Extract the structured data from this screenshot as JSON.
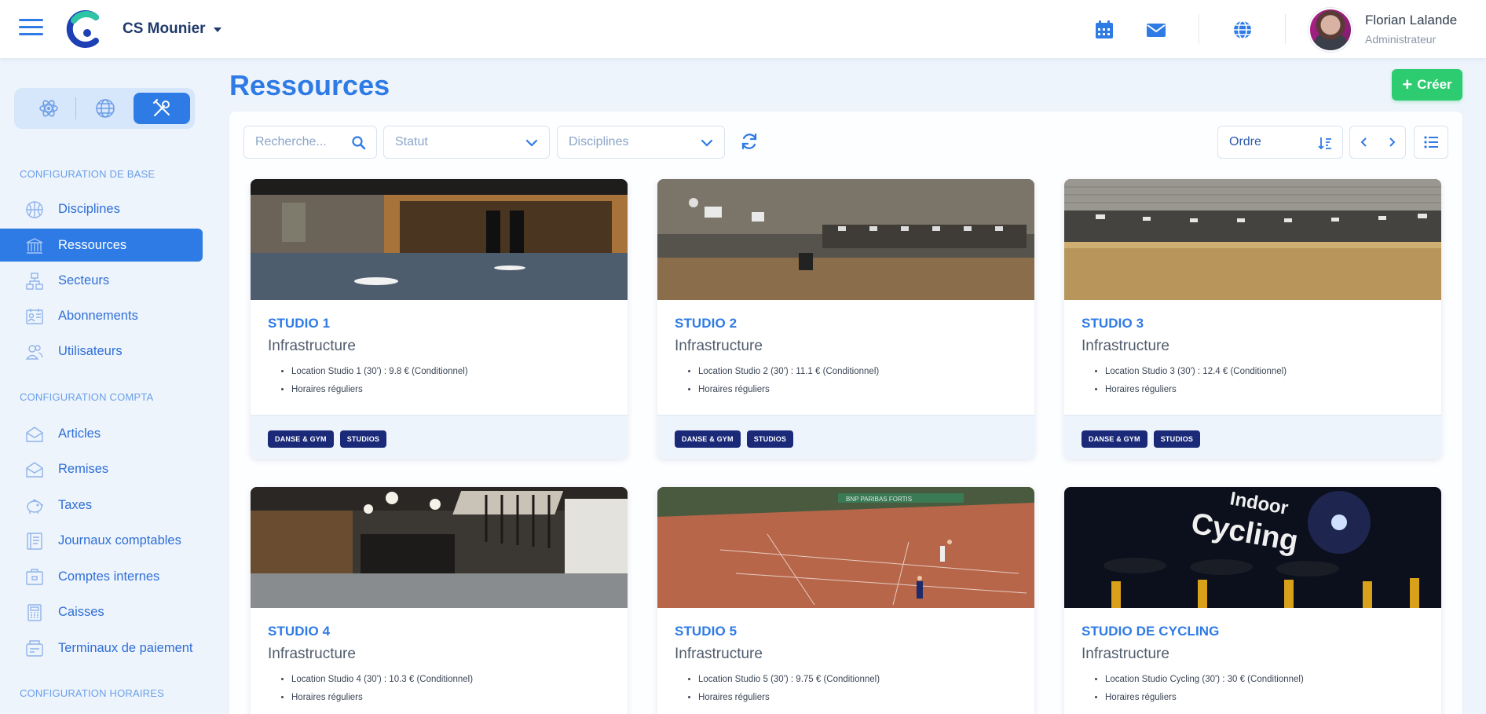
{
  "header": {
    "org_name": "CS Mounier",
    "user": {
      "name": "Florian Lalande",
      "role": "Administrateur"
    },
    "icons": [
      "menu-icon",
      "calendar-icon",
      "mail-icon",
      "globe-icon"
    ]
  },
  "sidebar": {
    "mode_switch": [
      "atom-icon",
      "globe-icon",
      "tools-icon"
    ],
    "sections": [
      {
        "title": "CONFIGURATION DE BASE",
        "items": [
          {
            "label": "Disciplines",
            "icon": "basketball-icon"
          },
          {
            "label": "Ressources",
            "icon": "building-icon",
            "active": true
          },
          {
            "label": "Secteurs",
            "icon": "sectors-icon"
          },
          {
            "label": "Abonnements",
            "icon": "card-icon"
          },
          {
            "label": "Utilisateurs",
            "icon": "users-icon"
          }
        ]
      },
      {
        "title": "CONFIGURATION COMPTA",
        "items": [
          {
            "label": "Articles",
            "icon": "envelope-open-icon"
          },
          {
            "label": "Remises",
            "icon": "envelope-open-icon"
          },
          {
            "label": "Taxes",
            "icon": "piggy-bank-icon"
          },
          {
            "label": "Journaux comptables",
            "icon": "ledger-icon"
          },
          {
            "label": "Comptes internes",
            "icon": "safe-icon"
          },
          {
            "label": "Caisses",
            "icon": "calculator-icon"
          },
          {
            "label": "Terminaux de paiement",
            "icon": "terminal-icon"
          }
        ]
      },
      {
        "title": "CONFIGURATION HORAIRES",
        "items": []
      }
    ]
  },
  "main": {
    "title": "Ressources",
    "create_label": "Créer",
    "filters": {
      "search_placeholder": "Recherche...",
      "status_placeholder": "Statut",
      "disciplines_placeholder": "Disciplines",
      "order_label": "Ordre"
    },
    "cards": [
      {
        "title": "STUDIO 1",
        "type": "Infrastructure",
        "details": [
          "Location Studio 1 (30') : 9.8 € (Conditionnel)",
          "Horaires réguliers"
        ],
        "tags": [
          "DANSE & GYM",
          "STUDIOS"
        ]
      },
      {
        "title": "STUDIO 2",
        "type": "Infrastructure",
        "details": [
          "Location Studio 2 (30') : 11.1 € (Conditionnel)",
          "Horaires réguliers"
        ],
        "tags": [
          "DANSE & GYM",
          "STUDIOS"
        ]
      },
      {
        "title": "STUDIO 3",
        "type": "Infrastructure",
        "details": [
          "Location Studio 3 (30') : 12.4 € (Conditionnel)",
          "Horaires réguliers"
        ],
        "tags": [
          "DANSE & GYM",
          "STUDIOS"
        ]
      },
      {
        "title": "STUDIO 4",
        "type": "Infrastructure",
        "details": [
          "Location Studio 4 (30') : 10.3 € (Conditionnel)",
          "Horaires réguliers"
        ],
        "tags": []
      },
      {
        "title": "STUDIO 5",
        "type": "Infrastructure",
        "details": [
          "Location Studio 5 (30') : 9.75 € (Conditionnel)",
          "Horaires réguliers"
        ],
        "tags": []
      },
      {
        "title": "STUDIO DE CYCLING",
        "type": "Infrastructure",
        "details": [
          "Location Studio Cycling (30') : 30 € (Conditionnel)",
          "Horaires réguliers"
        ],
        "tags": []
      }
    ],
    "image_texts": {
      "cycling": [
        "Indoor",
        "Cycling"
      ],
      "tennis_banner": "BNP PARIBAS FORTIS"
    }
  },
  "colors": {
    "primary": "#2f7be5",
    "success": "#2ecc71",
    "tag": "#1b2a78",
    "background": "#eef4fc"
  }
}
